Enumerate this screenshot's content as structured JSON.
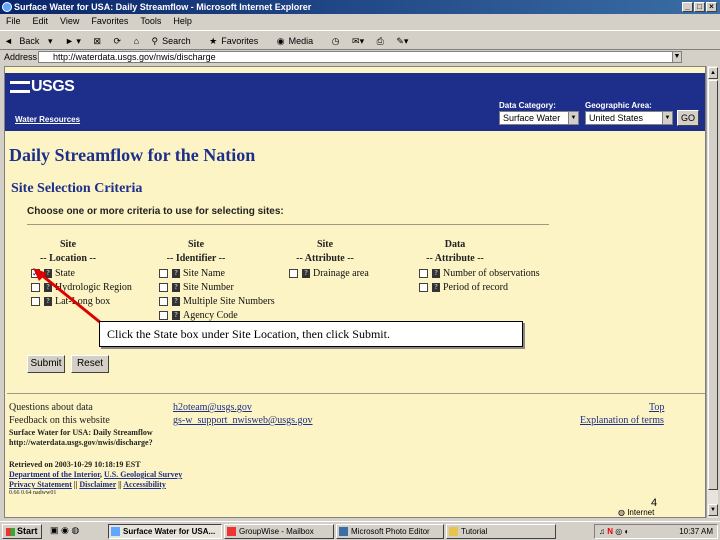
{
  "window": {
    "title": "Surface Water for USA: Daily Streamflow - Microsoft Internet Explorer",
    "controls": [
      "_",
      "□",
      "×"
    ]
  },
  "menu": [
    "File",
    "Edit",
    "View",
    "Favorites",
    "Tools",
    "Help"
  ],
  "toolbar": {
    "back": "Back",
    "search": "Search",
    "favorites": "Favorites",
    "media": "Media"
  },
  "address": {
    "label": "Address",
    "url": "http://waterdata.usgs.gov/nwis/discharge"
  },
  "header": {
    "logo": "USGS",
    "water_resources": "Water Resources",
    "data_category_label": "Data Category:",
    "data_category_value": "Surface Water",
    "geo_area_label": "Geographic Area:",
    "geo_area_value": "United States",
    "go": "GO"
  },
  "main": {
    "title": "Daily Streamflow for the Nation",
    "section": "Site Selection Criteria",
    "instructions": "Choose one or more criteria to use for selecting sites:",
    "columns": [
      {
        "line1": "Site",
        "line2": "-- Location --"
      },
      {
        "line1": "Site",
        "line2": "-- Identifier --"
      },
      {
        "line1": "Site",
        "line2": "-- Attribute --"
      },
      {
        "line1": "Data",
        "line2": "-- Attribute --"
      }
    ],
    "location_options": [
      "State",
      "Hydrologic Region",
      "Lat-Long box"
    ],
    "identifier_options": [
      "Site Name",
      "Site Number",
      "Multiple Site Numbers",
      "Agency Code"
    ],
    "site_attribute_options": [
      "Drainage area"
    ],
    "data_attribute_options": [
      "Number of observations",
      "Period of record"
    ],
    "submit": "Submit",
    "reset": "Reset"
  },
  "callout": "Click the State box under Site Location, then click Submit.",
  "footer": {
    "questions_label": "Questions about data",
    "questions_email": "h2oteam@usgs.gov",
    "feedback_label": "Feedback on this website",
    "feedback_email": "gs-w_support_nwisweb@usgs.gov",
    "top": "Top",
    "explanation": "Explanation of terms",
    "page_name": "Surface Water for USA: Daily Streamflow",
    "page_url": "http://waterdata.usgs.gov/nwis/discharge?",
    "retrieved": "Retrieved on 2003-10-29 10:18:19 EST",
    "doi": "Department of the Interior",
    "usgs": "U.S. Geological Survey",
    "privacy": "Privacy Statement",
    "disclaimer": "Disclaimer",
    "accessibility": "Accessibility",
    "sep": "||",
    "version": "0.66   0.64 nadww01"
  },
  "slide_number": "4",
  "status": {
    "zone": "Internet"
  },
  "taskbar": {
    "start": "Start",
    "tasks": [
      "Surface Water for USA...",
      "GroupWise - Mailbox",
      "Microsoft Photo Editor",
      "Tutorial"
    ],
    "clock": "10:37 AM"
  },
  "colors": {
    "usgs_blue": "#1d2f8a",
    "page_bg": "#fcf4c4",
    "arrow": "#e00000"
  }
}
